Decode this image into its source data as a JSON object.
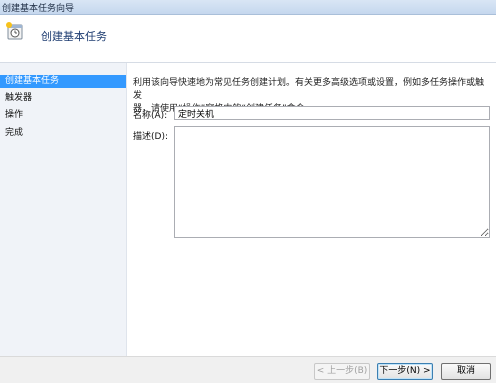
{
  "window": {
    "title": "创建基本任务向导"
  },
  "header": {
    "title": "创建基本任务",
    "icon": "scheduled-task-clock-icon"
  },
  "sidebar": {
    "items": [
      {
        "label": "创建基本任务",
        "active": true
      },
      {
        "label": "触发器",
        "active": false
      },
      {
        "label": "操作",
        "active": false
      },
      {
        "label": "完成",
        "active": false
      }
    ]
  },
  "main": {
    "description_line1": "利用该向导快速地为常见任务创建计划。有关更多高级选项或设置，例如多任务操作或触发",
    "description_line2": "器，请使用“操作”窗格中的“创建任务”命令。",
    "name_label": "名称(A):",
    "name_value": "定时关机",
    "desc_label": "描述(D):",
    "desc_value": ""
  },
  "footer": {
    "back_label": "< 上一步(B)",
    "next_label": "下一步(N) >",
    "cancel_label": "取消"
  }
}
